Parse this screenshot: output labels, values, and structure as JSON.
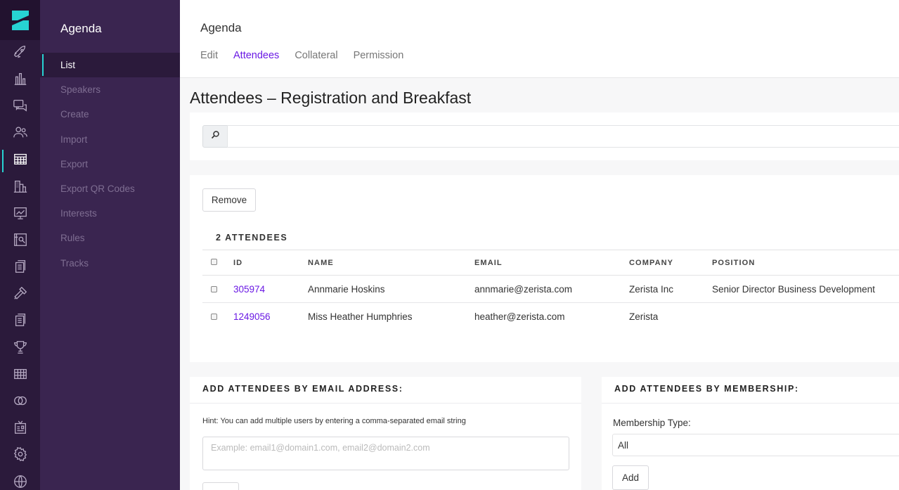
{
  "rail": {
    "icons": [
      "rocket-icon",
      "bar-chart-icon",
      "chat-icon",
      "people-icon",
      "calendar-grid-icon",
      "buildings-icon",
      "presentation-icon",
      "map-icon",
      "documents-icon",
      "gavel-icon",
      "documents-icon",
      "trophy-icon",
      "table-icon",
      "rings-icon",
      "badge-icon",
      "gear-icon",
      "globe-icon"
    ],
    "accent": "#27d3d3"
  },
  "subnav": {
    "title": "Agenda",
    "items": [
      "List",
      "Speakers",
      "Create",
      "Import",
      "Export",
      "Export QR Codes",
      "Interests",
      "Rules",
      "Tracks"
    ]
  },
  "header": {
    "title": "Agenda",
    "tabs": [
      "Edit",
      "Attendees",
      "Collateral",
      "Permission"
    ],
    "active_tab": "Attendees"
  },
  "page": {
    "heading": "Attendees – Registration and Breakfast"
  },
  "search": {
    "placeholder": "",
    "icon": "search-icon"
  },
  "list": {
    "remove_label": "Remove",
    "count_label": "2 ATTENDEES",
    "columns": [
      "ID",
      "NAME",
      "EMAIL",
      "COMPANY",
      "POSITION"
    ],
    "rows": [
      {
        "id": "305974",
        "name": "Annmarie Hoskins",
        "email": "annmarie@zerista.com",
        "company": "Zerista Inc",
        "position": "Senior Director Business Development"
      },
      {
        "id": "1249056",
        "name": "Miss Heather Humphries",
        "email": "heather@zerista.com",
        "company": "Zerista",
        "position": ""
      }
    ]
  },
  "add_email": {
    "title": "ADD ATTENDEES BY EMAIL ADDRESS:",
    "hint": "Hint: You can add multiple users by entering a comma-separated email string",
    "placeholder": "Example: email1@domain1.com, email2@domain2.com"
  },
  "add_membership": {
    "title": "ADD ATTENDEES BY MEMBERSHIP:",
    "label": "Membership Type:",
    "selected": "All",
    "add_label": "Add"
  },
  "colors": {
    "link": "#6a19e4",
    "sidebar": "#2b1a3b",
    "subnav": "#3a2550"
  }
}
